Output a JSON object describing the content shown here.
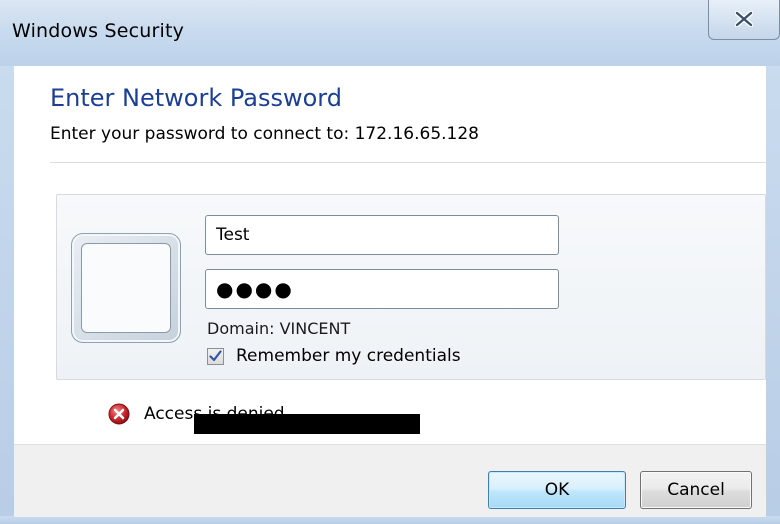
{
  "window": {
    "title": "Windows Security"
  },
  "dialog": {
    "heading": "Enter Network Password",
    "subheading": "Enter your password to connect to: 172.16.65.128"
  },
  "credentials": {
    "username_value": "Test",
    "password_value": "●●●●",
    "domain_text": "Domain: VINCENT",
    "remember_label": "Remember my credentials",
    "remember_checked": true
  },
  "error": {
    "text": "Access is denied."
  },
  "buttons": {
    "ok_label": "OK",
    "cancel_label": "Cancel"
  },
  "icons": {
    "close": "close-icon",
    "user_tile": "user-tile-icon",
    "error": "error-icon",
    "check": "checkmark-icon"
  },
  "colors": {
    "heading": "#1c3f94",
    "error_red": "#c8242b",
    "titlebar": "#c9dbee"
  }
}
